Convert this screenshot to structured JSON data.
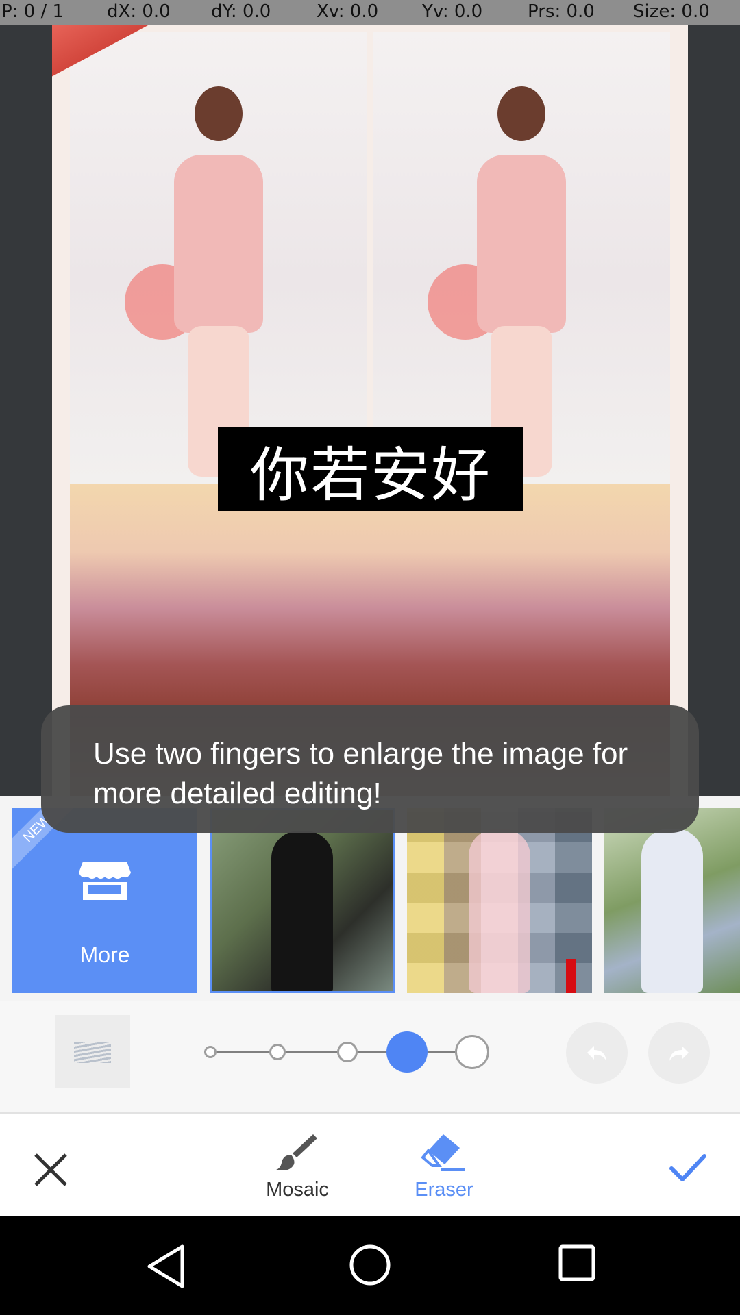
{
  "debug": {
    "pointer": "P: 0 / 1",
    "dx": "dX: 0.0",
    "dy": "dY: 0.0",
    "xv": "Xv: 0.0",
    "yv": "Yv: 0.0",
    "prs": "Prs: 0.0",
    "size": "Size: 0.0"
  },
  "canvas": {
    "overlay_text": "你若安好"
  },
  "tooltip": {
    "text": "Use two fingers to enlarge the image for more detailed editing!"
  },
  "effects": {
    "more_badge": "NEW",
    "more_label": "More",
    "selected_index": 1
  },
  "brush": {
    "sizes": 5,
    "selected_size": 4
  },
  "toolbar": {
    "mosaic_label": "Mosaic",
    "eraser_label": "Eraser",
    "active_tool": "Eraser"
  },
  "colors": {
    "accent": "#5b8ff5",
    "tooltip_bg": "#4b4b4b",
    "canvas_bg": "#35383b"
  }
}
